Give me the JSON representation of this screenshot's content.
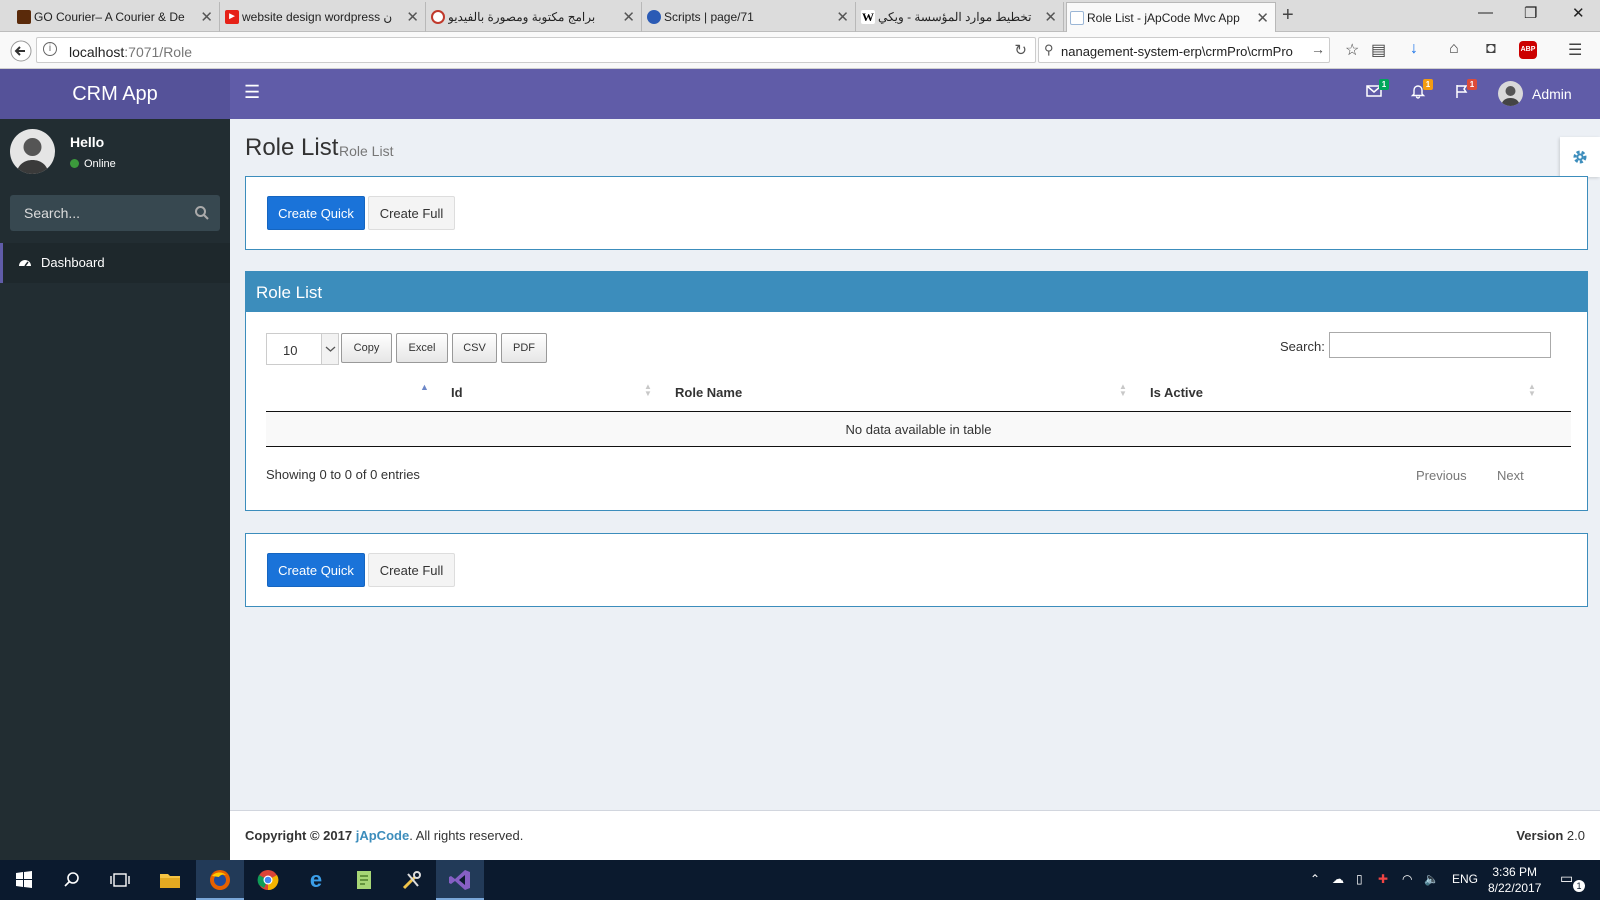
{
  "browser": {
    "tabs": [
      {
        "label": "GO Courier– A Courier & De",
        "favicon_color": "#5a2a0a",
        "active": false
      },
      {
        "label": "website design wordpress ‫ن",
        "favicon_color": "#e62117",
        "active": false
      },
      {
        "label": "برامج مكتوبة ومصورة بالفيديو",
        "favicon_color": "#c0392b",
        "active": false
      },
      {
        "label": "Scripts | page/71",
        "favicon_color": "#2b5bb5",
        "active": false
      },
      {
        "label": "تخطيط موارد المؤسسة - ويكي",
        "favicon_color": "#ffffff",
        "favicon_text": "W",
        "active": false
      },
      {
        "label": "Role List - jApCode Mvc App",
        "favicon_color": "#9bb6d6",
        "active": true
      }
    ],
    "url_host": "localhost",
    "url_path": ":7071/Role",
    "search_value": "nanagement-system-erp\\crmPro\\crmPro"
  },
  "app": {
    "logo": "CRM App",
    "header": {
      "mail_badge": "1",
      "bell_badge": "1",
      "flag_badge": "1",
      "user_name": "Admin",
      "colors": {
        "mail": "#00a65a",
        "bell": "#f39c12",
        "flag": "#dd4b39"
      }
    },
    "sidebar": {
      "greeting": "Hello",
      "status": "Online",
      "search_placeholder": "Search...",
      "menu": [
        {
          "label": "Dashboard",
          "icon": "dashboard-icon"
        }
      ]
    },
    "page": {
      "title": "Role List",
      "subtitle": "Role List"
    },
    "actions": {
      "create_quick": "Create Quick",
      "create_full": "Create Full"
    },
    "table_box": {
      "title": "Role List",
      "page_length": "10",
      "buttons": [
        "Copy",
        "Excel",
        "CSV",
        "PDF"
      ],
      "search_label": "Search:",
      "columns": [
        "",
        "Id",
        "Role Name",
        "Is Active"
      ],
      "empty_message": "No data available in table",
      "info": "Showing 0 to 0 of 0 entries",
      "previous": "Previous",
      "next": "Next"
    },
    "footer": {
      "copyright_prefix": "Copyright © 2017",
      "brand": "jApCode",
      "suffix": ". All rights reserved.",
      "version_label": "Version",
      "version_value": "2.0"
    },
    "theme": {
      "primary": "#605ca8",
      "box": "#3c8dbc",
      "sidebar": "#222d32"
    }
  },
  "taskbar": {
    "language": "ENG",
    "time": "3:36 PM",
    "date": "8/22/2017",
    "notification_count": "1"
  }
}
